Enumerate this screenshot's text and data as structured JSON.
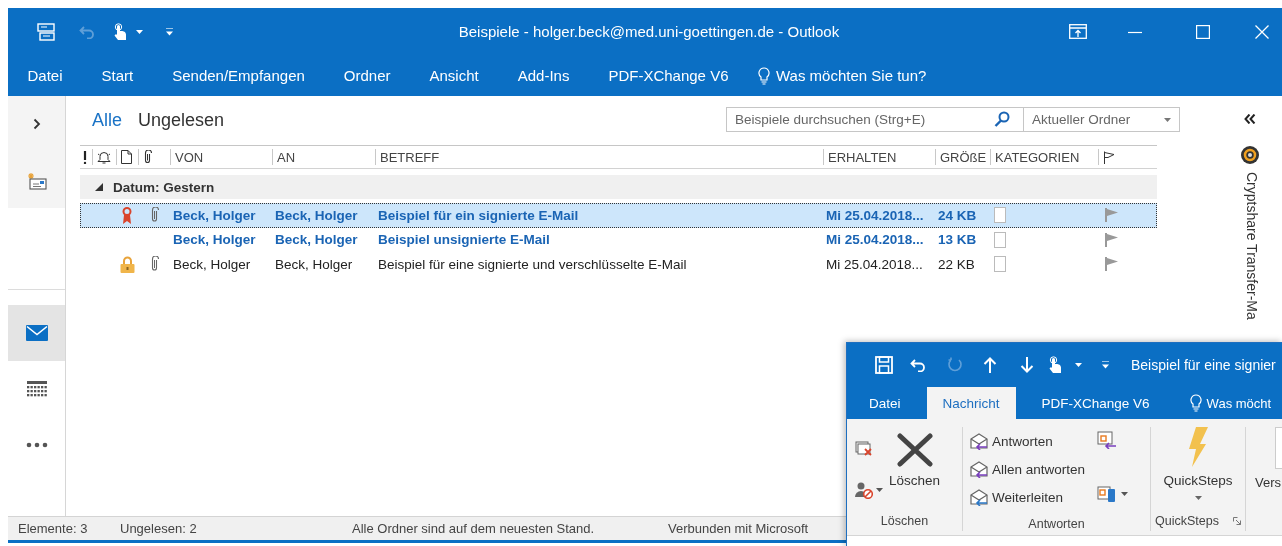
{
  "window": {
    "title": "Beispiele - holger.beck@med.uni-goettingen.de - Outlook"
  },
  "ribbon_tabs": [
    {
      "label": "Datei",
      "selected": false
    },
    {
      "label": "Start",
      "selected": false
    },
    {
      "label": "Senden/Empfangen",
      "selected": false
    },
    {
      "label": "Ordner",
      "selected": false
    },
    {
      "label": "Ansicht",
      "selected": false
    },
    {
      "label": "Add-Ins",
      "selected": false
    },
    {
      "label": "PDF-XChange V6",
      "selected": false
    }
  ],
  "tell_me": "Was möchten Sie tun?",
  "nav": [
    {
      "kind": "mail",
      "selected": true
    },
    {
      "kind": "calendar",
      "selected": false
    },
    {
      "kind": "more",
      "selected": false
    }
  ],
  "filter_tabs": [
    {
      "label": "Alle",
      "selected": true
    },
    {
      "label": "Ungelesen",
      "selected": false
    }
  ],
  "search": {
    "placeholder": "Beispiele durchsuchen (Strg+E)",
    "scope": "Aktueller Ordner"
  },
  "table": {
    "columns": [
      "VON",
      "AN",
      "BETREFF",
      "ERHALTEN",
      "GRÖßE",
      "KATEGORIEN"
    ],
    "group": {
      "label": "Datum: Gestern",
      "expanded": true
    },
    "rows": [
      {
        "kind": "signed",
        "attachment": true,
        "unread": true,
        "selected": true,
        "from": "Beck, Holger",
        "to": "Beck, Holger",
        "subject": "Beispiel für ein signierte E-Mail",
        "received": "Mi 25.04.2018...",
        "size": "24 KB"
      },
      {
        "kind": "plain",
        "attachment": false,
        "unread": true,
        "selected": false,
        "from": "Beck, Holger",
        "to": "Beck, Holger",
        "subject": "Beispiel unsignierte E-Mail",
        "received": "Mi 25.04.2018...",
        "size": "13 KB"
      },
      {
        "kind": "encrypted",
        "attachment": true,
        "unread": false,
        "selected": false,
        "from": "Beck, Holger",
        "to": "Beck, Holger",
        "subject": "Beispiel für eine signierte und verschlüsselte E-Mail",
        "received": "Mi 25.04.2018...",
        "size": "22 KB"
      }
    ]
  },
  "side_pane": {
    "title": "Cryptshare Transfer-Ma"
  },
  "status_bar": [
    "Elemente: 3",
    "Ungelesen: 2",
    "Alle Ordner sind auf dem neuesten Stand.",
    "Verbunden mit Microsoft"
  ],
  "message_window": {
    "title": "Beispiel für eine signier",
    "tabs": [
      {
        "label": "Datei",
        "selected": false
      },
      {
        "label": "Nachricht",
        "selected": true
      },
      {
        "label": "PDF-XChange V6",
        "selected": false
      }
    ],
    "tell_me": "Was möcht",
    "groups": [
      {
        "kind": "delete",
        "label": "Löschen",
        "buttons": [
          "Löschen"
        ]
      },
      {
        "kind": "respond",
        "label": "Antworten",
        "buttons": [
          "Antworten",
          "Allen antworten",
          "Weiterleiten"
        ]
      },
      {
        "kind": "quicksteps",
        "label": "QuickSteps",
        "buttons": [
          "QuickSteps"
        ]
      }
    ],
    "next_button": "Vers"
  }
}
